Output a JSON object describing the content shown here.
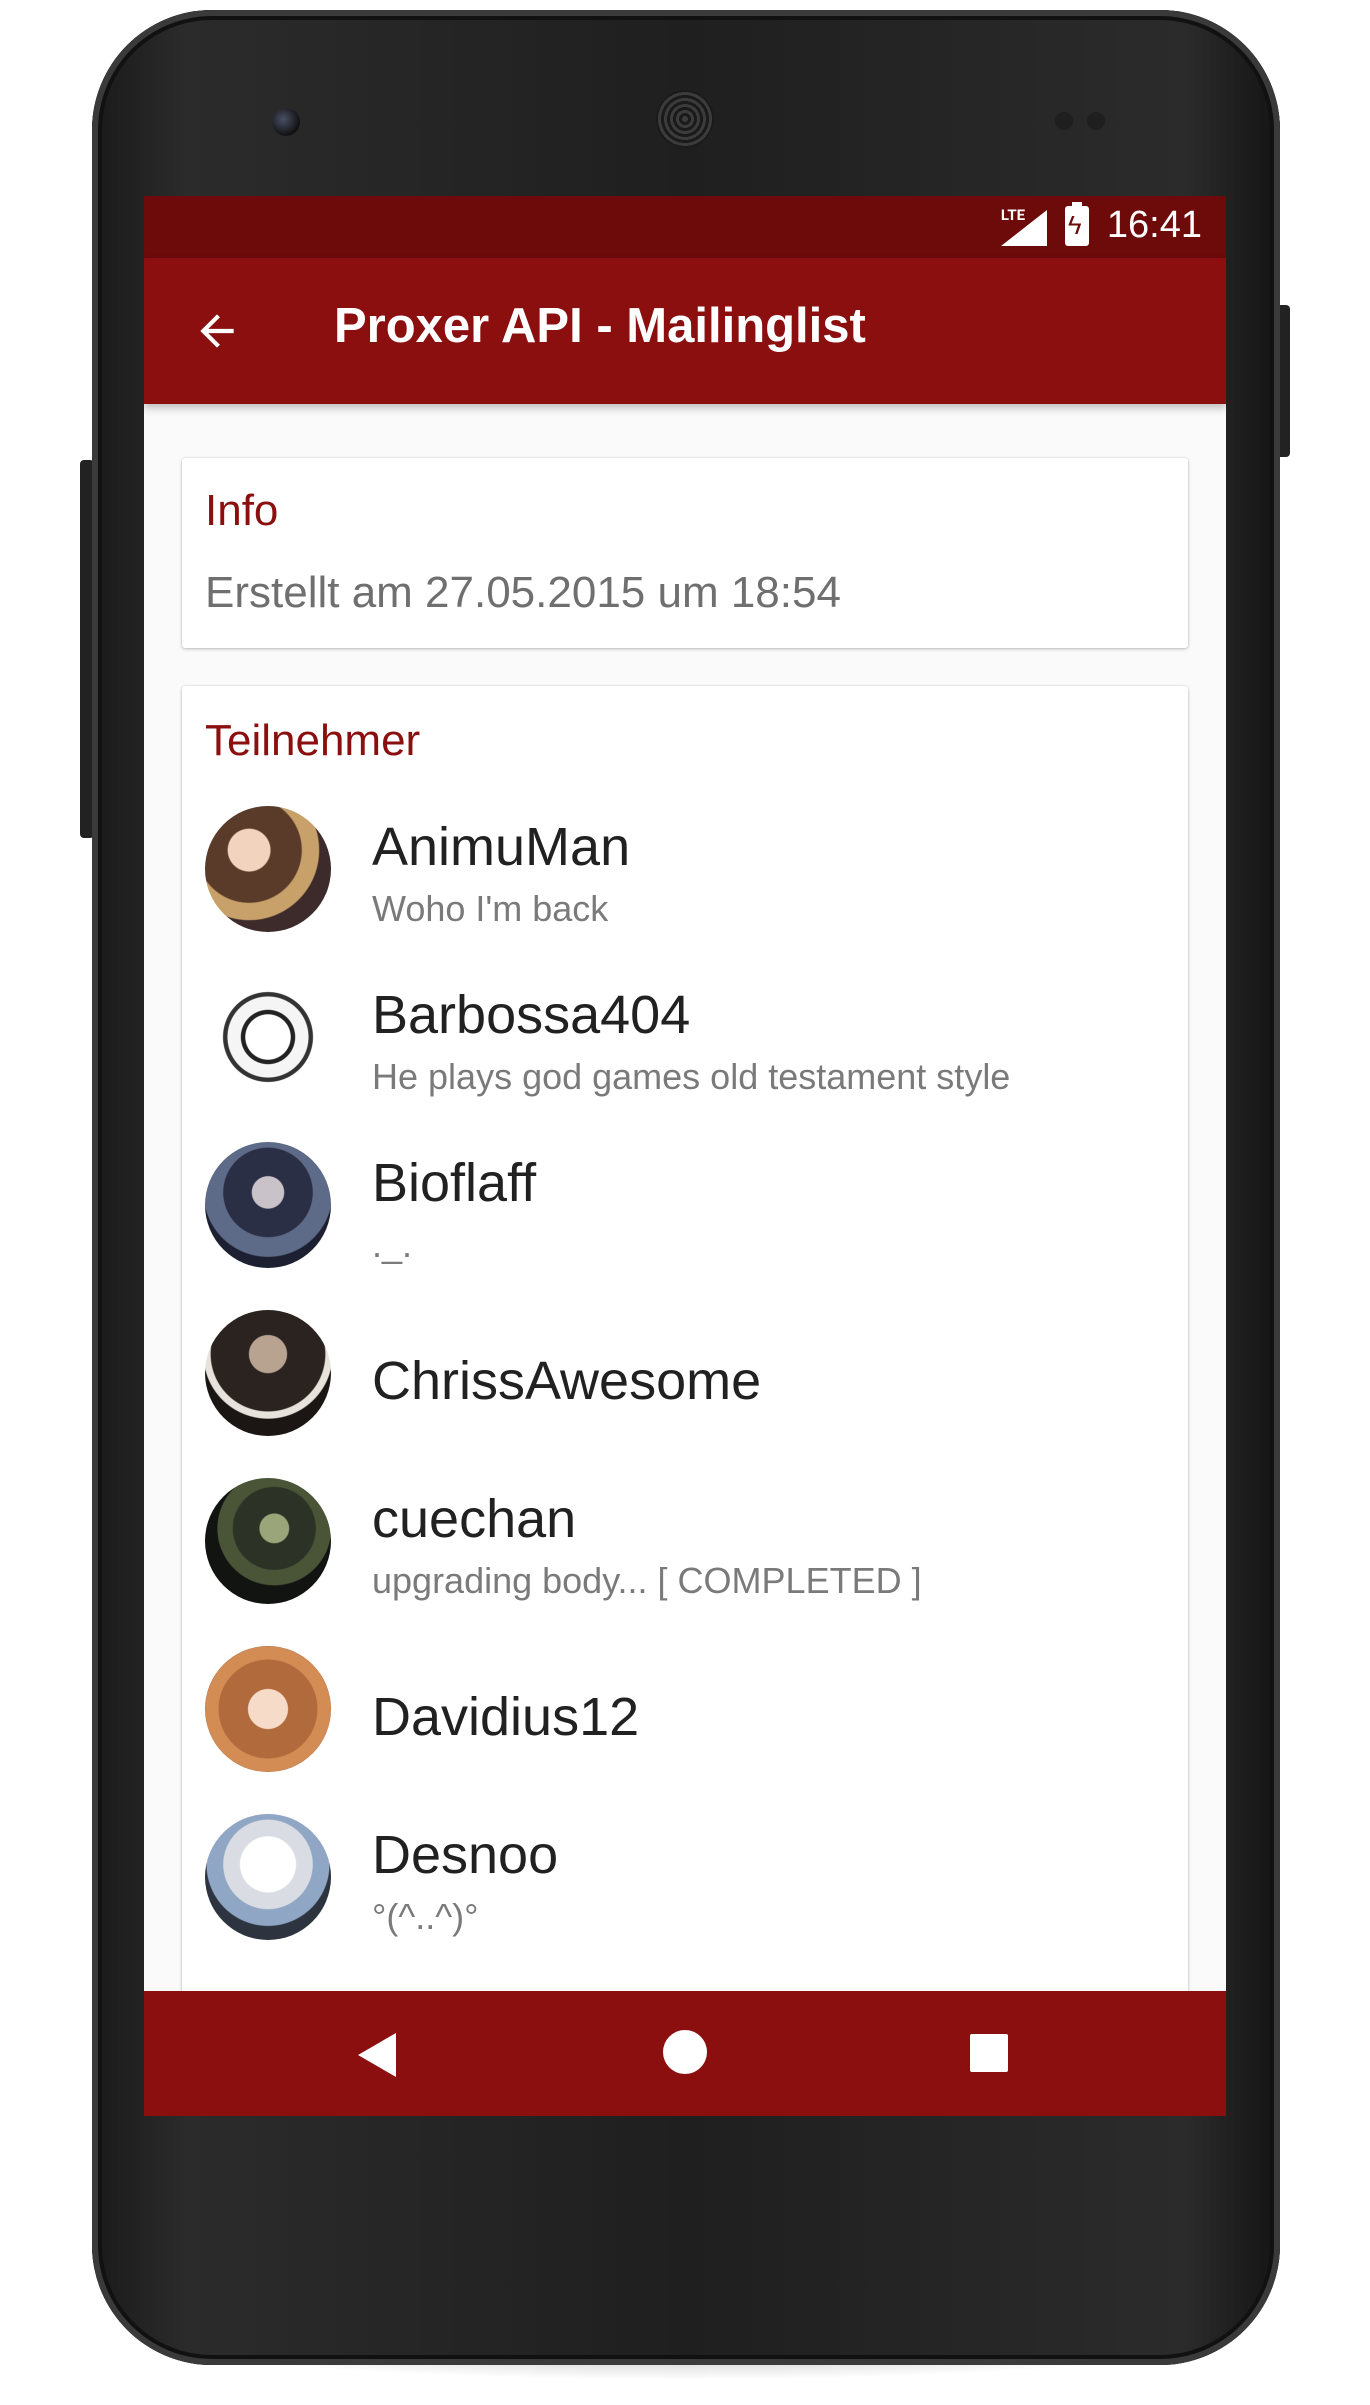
{
  "statusbar": {
    "network": "LTE",
    "time": "16:41"
  },
  "appbar": {
    "title": "Proxer API - Mailinglist",
    "back_icon": "arrow-left-icon"
  },
  "info": {
    "heading": "Info",
    "created": "Erstellt am 27.05.2015 um 18:54"
  },
  "members": {
    "heading": "Teilnehmer",
    "items": [
      {
        "name": "AnimuMan",
        "status": "Woho I'm back"
      },
      {
        "name": "Barbossa404",
        "status": "He plays god games old testament style"
      },
      {
        "name": "Bioflaff",
        "status": "._."
      },
      {
        "name": "ChrissAwesome",
        "status": ""
      },
      {
        "name": "cuechan",
        "status": "upgrading body... [ COMPLETED ]"
      },
      {
        "name": "Davidius12",
        "status": ""
      },
      {
        "name": "Desnoo",
        "status": "°(^..^)°"
      }
    ]
  },
  "navbar": {
    "back": "nav-back-icon",
    "home": "nav-home-icon",
    "recents": "nav-recents-icon"
  },
  "colors": {
    "primary": "#8b0f0f",
    "primary_dark": "#6d0a0a",
    "accent_text": "#8b0f0f",
    "background": "#fafafa"
  }
}
